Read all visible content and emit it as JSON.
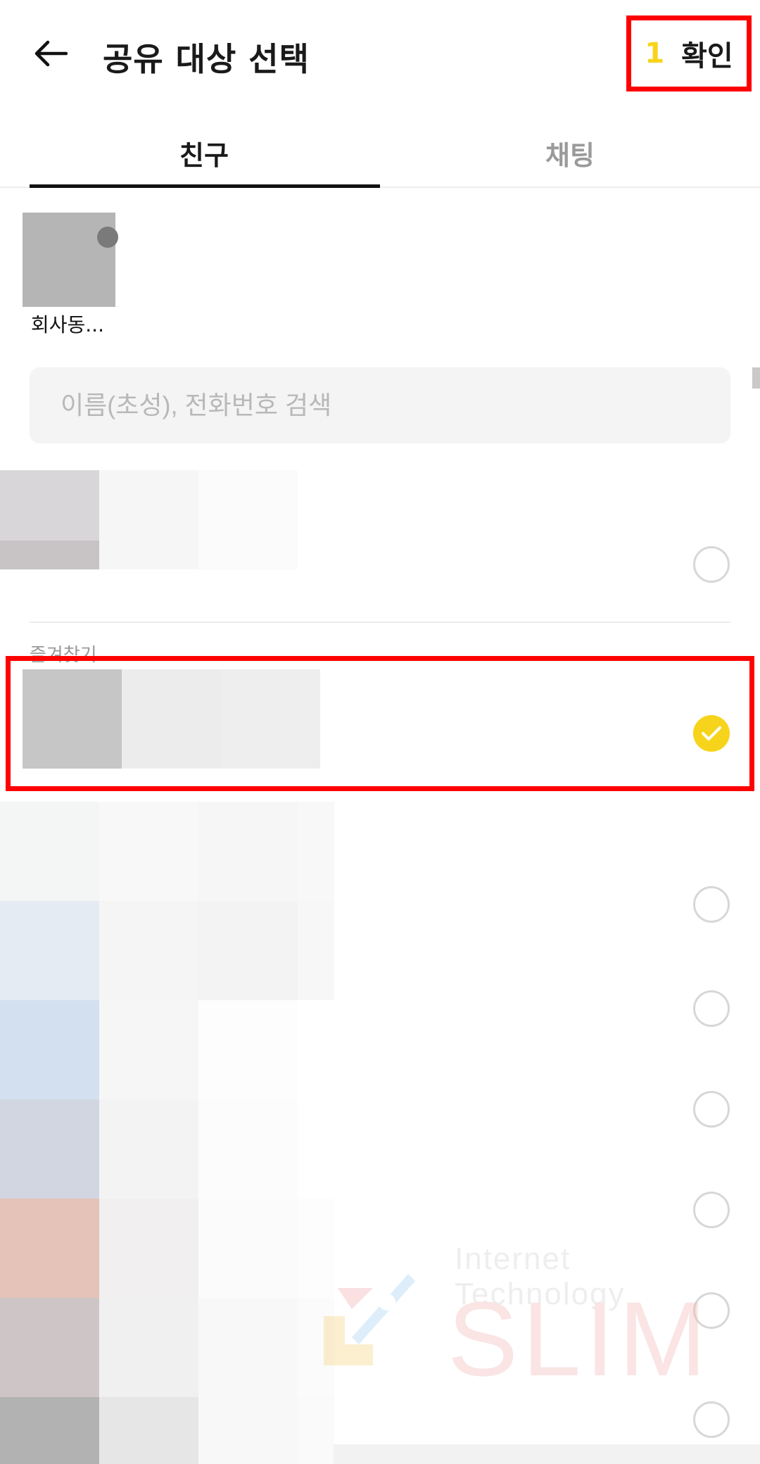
{
  "header": {
    "title": "공유 대상 선택",
    "selected_count": "1",
    "confirm_label": "확인",
    "back_icon": "arrow-left-icon"
  },
  "tabs": [
    {
      "label": "친구",
      "active": true
    },
    {
      "label": "채팅",
      "active": false
    }
  ],
  "selected_chip": {
    "name": "회사동..."
  },
  "search": {
    "placeholder": "이름(초성), 전화번호 검색"
  },
  "list": {
    "section_label": "즐겨찾기",
    "rows": [
      {
        "checked": false
      },
      {
        "checked": true
      },
      {
        "checked": false
      },
      {
        "checked": false
      },
      {
        "checked": false
      },
      {
        "checked": false
      },
      {
        "checked": false
      },
      {
        "checked": false
      }
    ]
  },
  "watermark": {
    "top_text": "Internet Technology",
    "main_text": "SLIM"
  },
  "colors": {
    "accent_yellow": "#f7d41c",
    "highlight_red": "#ff0000"
  }
}
